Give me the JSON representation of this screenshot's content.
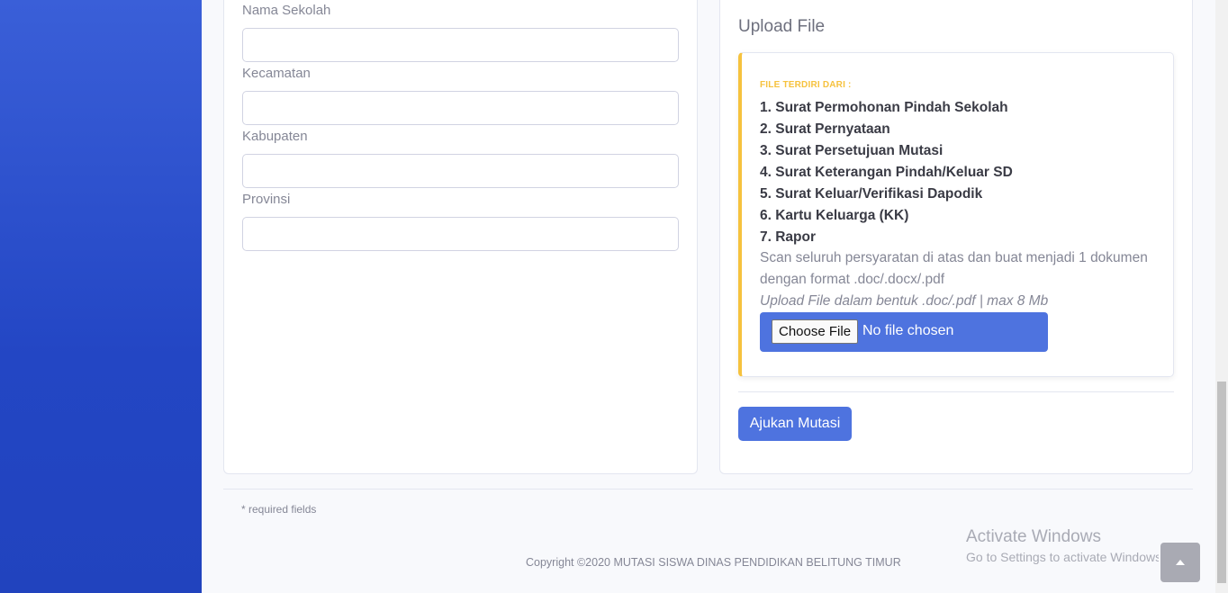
{
  "form": {
    "fields": [
      {
        "label": "Nama Sekolah",
        "value": ""
      },
      {
        "label": "Kecamatan",
        "value": ""
      },
      {
        "label": "Kabupaten",
        "value": ""
      },
      {
        "label": "Provinsi",
        "value": ""
      }
    ]
  },
  "upload": {
    "title": "Upload File",
    "heading": "FILE TERDIRI DARI :",
    "requirements": [
      "1. Surat Permohonan Pindah Sekolah",
      "2. Surat Pernyataan",
      "3. Surat Persetujuan Mutasi",
      "4. Surat Keterangan Pindah/Keluar SD",
      "5. Surat Keluar/Verifikasi Dapodik",
      "6. Kartu Keluarga (KK)",
      "7. Rapor"
    ],
    "note": "Scan seluruh persyaratan di atas dan buat menjadi 1 dokumen dengan format .doc/.docx/.pdf",
    "hint": "Upload File dalam bentuk .doc/.pdf | max 8 Mb",
    "choose_label": "Choose File",
    "no_file_label": "No file chosen"
  },
  "submit_label": "Ajukan Mutasi",
  "footer": {
    "required_note": "* required fields",
    "copyright": "Copyright ©2020 MUTASI SISWA DINAS PENDIDIKAN BELITUNG TIMUR"
  },
  "watermark": {
    "line1": "Activate Windows",
    "line2": "Go to Settings to activate Windows."
  },
  "icons": {
    "scroll_top": "chevron-up-icon"
  },
  "colors": {
    "primary": "#4e73df",
    "warning": "#f6c23e",
    "sidebar": "#2346c4"
  }
}
